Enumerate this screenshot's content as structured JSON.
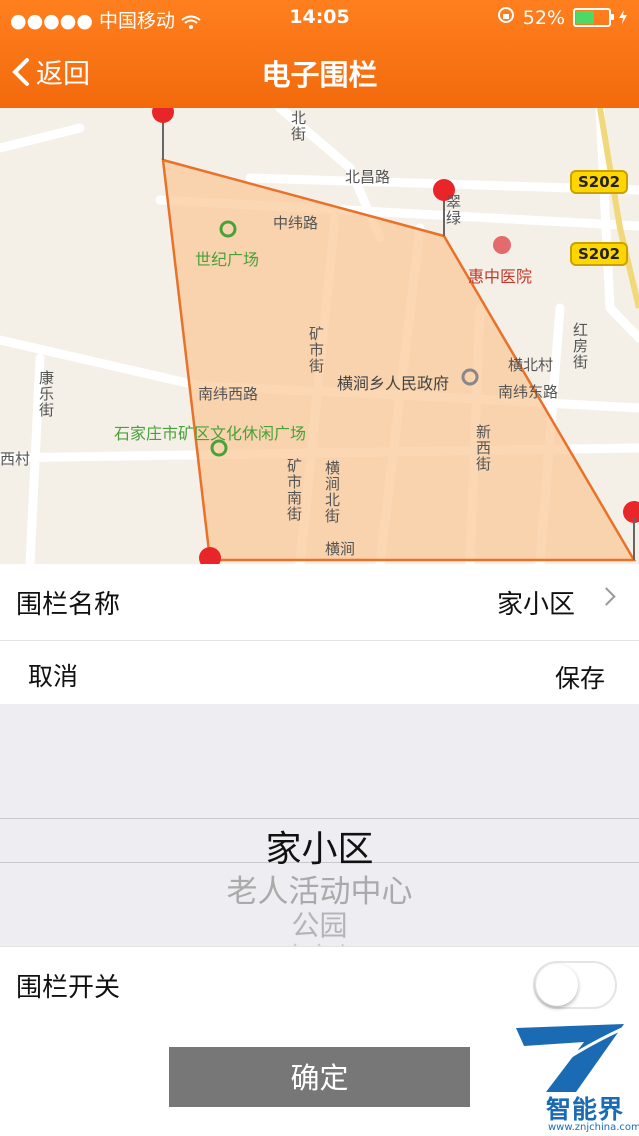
{
  "status_bar": {
    "signal": "●●●●●",
    "carrier": "中国移动",
    "time": "14:05",
    "battery_percent": "52%",
    "battery_level": 0.52
  },
  "nav": {
    "back_label": "返回",
    "title": "电子围栏"
  },
  "map": {
    "labels": {
      "north_street": "北街",
      "beichang_rd": "北昌路",
      "zhongwei_rd": "中纬路",
      "century_square": "世纪广场",
      "huizhong_hospital": "惠中医院",
      "cuilv": "翠绿",
      "s202_a": "S202",
      "s202_b": "S202",
      "kuangshi_st": "矿市街",
      "henggan_govt": "横涧乡人民政府",
      "hengbei_village": "横北村",
      "hongfang_st": "红房街",
      "nanwei_west_rd": "南纬西路",
      "nanwei_east_rd": "南纬东路",
      "kangle_st": "康乐街",
      "leisure_square": "石家庄市矿区文化休闲广场",
      "xi_village": "西村",
      "kuangshi_south_st": "矿市南街",
      "hengjian_north_st": "横涧北街",
      "xinxi_st": "新西街",
      "hengjian": "横涧"
    },
    "colors": {
      "fence_fill": "#fbc999",
      "fence_stroke": "#e8722a",
      "road": "#ffffff",
      "bg": "#f4f0e7"
    }
  },
  "fence_name_row": {
    "label": "围栏名称",
    "value": "家小区"
  },
  "action_bar": {
    "cancel_label": "取消",
    "save_label": "保存"
  },
  "picker": {
    "options": [
      "家小区",
      "老人活动中心",
      "公园",
      "自家义"
    ],
    "selected_index": 0
  },
  "switch_row": {
    "label": "围栏开关",
    "on": false
  },
  "confirm_label": "确定",
  "watermark": {
    "name": "智能界",
    "url": "www.znjchina.com"
  }
}
